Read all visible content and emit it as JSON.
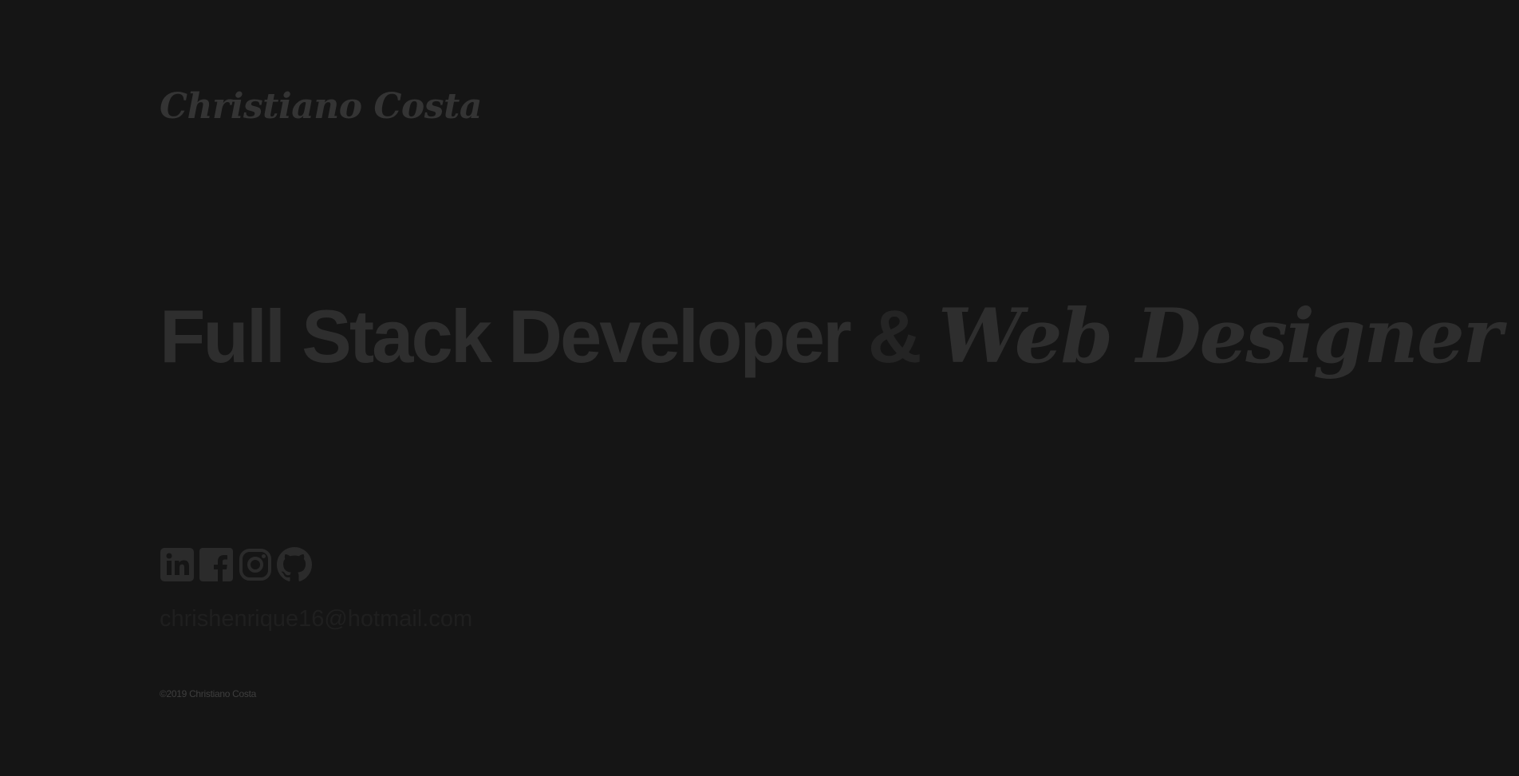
{
  "header": {
    "logo_text": "Christiano Costa"
  },
  "hero": {
    "title_main": "Full Stack Developer",
    "title_amp": "&",
    "title_script": "Web Designer"
  },
  "socials": [
    {
      "name": "LinkedIn",
      "icon": "linkedin-icon"
    },
    {
      "name": "Facebook",
      "icon": "facebook-icon"
    },
    {
      "name": "Instagram",
      "icon": "instagram-icon"
    },
    {
      "name": "GitHub",
      "icon": "github-icon"
    }
  ],
  "contact": {
    "email": "chrishenrique16@hotmail.com"
  },
  "footer": {
    "copyright": "©2019 Christiano Costa"
  },
  "colors": {
    "background": "#151515",
    "text_dim": "#2e2e2e",
    "icon": "#2b2b2b",
    "email": "#1f1f1f",
    "copyright": "#3e3e3e"
  }
}
